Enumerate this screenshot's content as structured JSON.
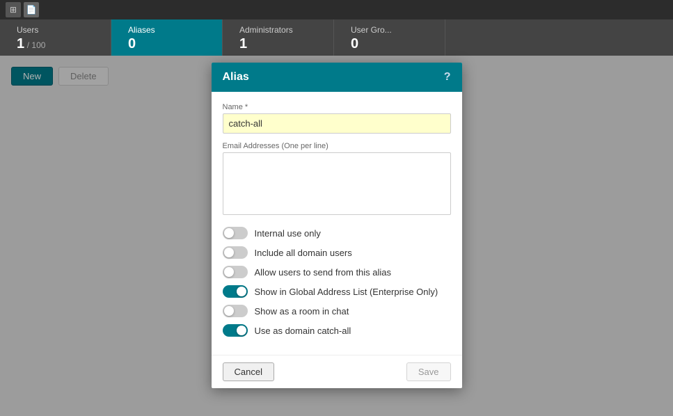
{
  "topbar": {
    "icons": [
      "grid-icon",
      "doc-icon"
    ]
  },
  "stats": {
    "tabs": [
      {
        "id": "users",
        "label": "Users",
        "value": "1",
        "total": "/ 100",
        "active": false
      },
      {
        "id": "aliases",
        "label": "Aliases",
        "value": "0",
        "total": "",
        "active": true
      },
      {
        "id": "administrators",
        "label": "Administrators",
        "value": "1",
        "total": "",
        "active": false
      },
      {
        "id": "usergroups",
        "label": "User Gro...",
        "value": "0",
        "total": "",
        "active": false
      }
    ]
  },
  "toolbar": {
    "new_label": "New",
    "delete_label": "Delete"
  },
  "modal": {
    "title": "Alias",
    "help_symbol": "?",
    "name_label": "Name *",
    "name_value": "catch-all",
    "email_label": "Email Addresses (One per line)",
    "email_value": "",
    "toggles": [
      {
        "id": "internal-use",
        "label": "Internal use only",
        "on": false
      },
      {
        "id": "include-all-domain",
        "label": "Include all domain users",
        "on": false
      },
      {
        "id": "allow-send",
        "label": "Allow users to send from this alias",
        "on": false
      },
      {
        "id": "show-global",
        "label": "Show in Global Address List (Enterprise Only)",
        "on": true
      },
      {
        "id": "show-room",
        "label": "Show as a room in chat",
        "on": false
      },
      {
        "id": "use-catchall",
        "label": "Use as domain catch-all",
        "on": true
      }
    ],
    "cancel_label": "Cancel",
    "save_label": "Save"
  }
}
